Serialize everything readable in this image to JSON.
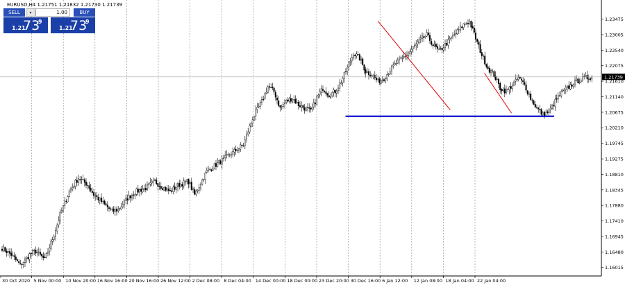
{
  "header": {
    "symbol_line": "EURUSD,H4  1.21751 1.21832 1.21730 1.21739"
  },
  "trade_panel": {
    "sell_label": "SELL",
    "buy_label": "BUY",
    "lot_value": "1.00",
    "sell_price_prefix": "1.21",
    "sell_price_big": "73",
    "sell_price_sup": "9",
    "buy_price_prefix": "1.21",
    "buy_price_big": "73",
    "buy_price_sup": "9",
    "dropdown_glyph": "▾"
  },
  "colors": {
    "bull": "#ffffff",
    "bear": "#000000",
    "support_line": "#0000cc",
    "trend_line": "#e00000",
    "grid": "#888888",
    "panel_blue": "#1a3fa8"
  },
  "chart_data": {
    "type": "candlestick",
    "symbol": "EURUSD",
    "timeframe": "H4",
    "current_price": 1.21739,
    "ylim": [
      1.158,
      1.2388
    ],
    "y_ticks": [
      "1.23475",
      "1.23005",
      "1.22540",
      "1.22075",
      "1.21610",
      "1.21140",
      "1.20675",
      "1.20210",
      "1.19745",
      "1.19275",
      "1.18810",
      "1.18345",
      "1.17880",
      "1.17410",
      "1.16945",
      "1.16480",
      "1.16015"
    ],
    "x_ticks": [
      "30 Oct 2020",
      "5 Nov 00:00",
      "10 Nov 20:00",
      "16 Nov 16:00",
      "20 Nov 16:00",
      "26 Nov 12:00",
      "2 Dec 08:00",
      "8 Dec 04:00",
      "14 Dec 00:00",
      "18 Dec 00:00",
      "23 Dec 20:00",
      "30 Dec 16:00",
      "6 Jan 12:00",
      "12 Jan 08:00",
      "18 Jan 04:00",
      "22 Jan 04:00"
    ],
    "path_points": [
      [
        0,
        1.166
      ],
      [
        6,
        1.164
      ],
      [
        12,
        1.1608
      ],
      [
        18,
        1.164
      ],
      [
        22,
        1.165
      ],
      [
        28,
        1.1625
      ],
      [
        34,
        1.17
      ],
      [
        38,
        1.176
      ],
      [
        44,
        1.183
      ],
      [
        50,
        1.187
      ],
      [
        56,
        1.185
      ],
      [
        60,
        1.182
      ],
      [
        66,
        1.1795
      ],
      [
        72,
        1.177
      ],
      [
        76,
        1.1775
      ],
      [
        82,
        1.181
      ],
      [
        88,
        1.183
      ],
      [
        94,
        1.184
      ],
      [
        100,
        1.186
      ],
      [
        104,
        1.1845
      ],
      [
        110,
        1.183
      ],
      [
        116,
        1.185
      ],
      [
        122,
        1.186
      ],
      [
        126,
        1.182
      ],
      [
        130,
        1.1855
      ],
      [
        134,
        1.189
      ],
      [
        140,
        1.191
      ],
      [
        146,
        1.193
      ],
      [
        152,
        1.195
      ],
      [
        158,
        1.197
      ],
      [
        164,
        1.205
      ],
      [
        170,
        1.21
      ],
      [
        174,
        1.2145
      ],
      [
        178,
        1.213
      ],
      [
        182,
        1.208
      ],
      [
        186,
        1.21
      ],
      [
        190,
        1.211
      ],
      [
        194,
        1.209
      ],
      [
        198,
        1.208
      ],
      [
        202,
        1.207
      ],
      [
        206,
        1.211
      ],
      [
        210,
        1.214
      ],
      [
        214,
        1.212
      ],
      [
        218,
        1.213
      ],
      [
        222,
        1.216
      ],
      [
        226,
        1.22
      ],
      [
        230,
        1.2245
      ],
      [
        234,
        1.223
      ],
      [
        238,
        1.219
      ],
      [
        242,
        1.218
      ],
      [
        246,
        1.216
      ],
      [
        250,
        1.217
      ],
      [
        254,
        1.2195
      ],
      [
        258,
        1.2215
      ],
      [
        262,
        1.223
      ],
      [
        266,
        1.2245
      ],
      [
        270,
        1.2265
      ],
      [
        274,
        1.2285
      ],
      [
        278,
        1.23
      ],
      [
        282,
        1.227
      ],
      [
        286,
        1.225
      ],
      [
        290,
        1.227
      ],
      [
        294,
        1.229
      ],
      [
        298,
        1.231
      ],
      [
        302,
        1.233
      ],
      [
        306,
        1.234
      ],
      [
        310,
        1.229
      ],
      [
        314,
        1.224
      ],
      [
        318,
        1.22
      ],
      [
        322,
        1.218
      ],
      [
        326,
        1.214
      ],
      [
        330,
        1.213
      ],
      [
        334,
        1.215
      ],
      [
        338,
        1.217
      ],
      [
        342,
        1.215
      ],
      [
        346,
        1.211
      ],
      [
        350,
        1.208
      ],
      [
        354,
        1.206
      ],
      [
        358,
        1.207
      ],
      [
        362,
        1.21
      ],
      [
        366,
        1.2125
      ],
      [
        370,
        1.214
      ],
      [
        374,
        1.2155
      ],
      [
        378,
        1.2165
      ],
      [
        382,
        1.217
      ],
      [
        386,
        1.2174
      ]
    ],
    "annotations": {
      "support_line": {
        "price": 1.20555,
        "from_index": 193,
        "to_index": 505
      },
      "downtrend_line": {
        "from": [
          337,
          1.2341
        ],
        "to": [
          391,
          1.2075
        ]
      },
      "projection_line": {
        "from": [
          393,
          1.2185
        ],
        "to": [
          418,
          1.2065
        ]
      }
    }
  }
}
